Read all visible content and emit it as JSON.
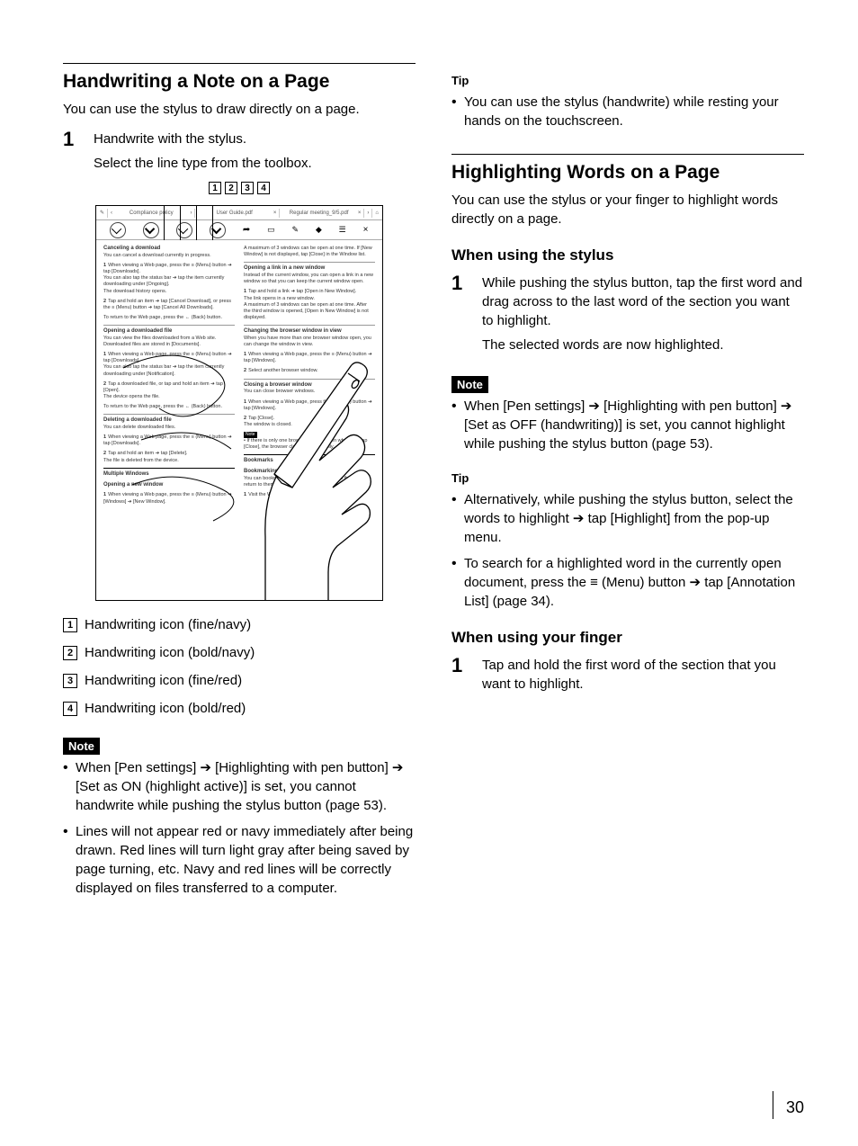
{
  "page_number": "30",
  "left": {
    "h1": "Handwriting a Note on a Page",
    "intro": "You can use the stylus to draw directly on a page.",
    "step1": {
      "num": "1",
      "line1": "Handwrite with the stylus.",
      "line2": "Select the line type from the toolbox."
    },
    "callouts": [
      "1",
      "2",
      "3",
      "4"
    ],
    "fig_toolbar": {
      "doc1": "Compliance policy",
      "doc2": "User Guide.pdf",
      "doc3": "Regular meeting_9/5.pdf"
    },
    "fig_body": {
      "canceling_h": "Canceling a download",
      "canceling_p": "You can cancel a download currently in progress.",
      "c1": "When viewing a Web page, press the ≡ (Menu) button ➔ tap [Downloads].",
      "c1b": "You can also tap the status bar ➔ tap the item currently downloading under [Ongoing].",
      "c1c": "The download history opens.",
      "c2": "Tap and hold an item ➔ tap [Cancel Download], or press the ≡ (Menu) button ➔ tap [Cancel All Downloads].",
      "c_ret": "To return to the Web page, press the ← (Back) button.",
      "open_h": "Opening a downloaded file",
      "open_p": "You can view the files downloaded from a Web site. Downloaded files are stored in [Documents].",
      "o1": "When viewing a Web page, press the ≡ (Menu) button ➔ tap [Downloads].",
      "o1b": "You can also tap the status bar ➔ tap the item currently downloading under [Notification].",
      "o2": "Tap a downloaded file, or tap and hold an item ➔ tap [Open].",
      "o2b": "The device opens the file.",
      "o_ret": "To return to the Web page, press the ← (Back) button.",
      "del_h": "Deleting a downloaded file",
      "del_p": "You can delete downloaded files.",
      "d1": "When viewing a Web page, press the ≡ (Menu) button ➔ tap [Downloads].",
      "d2": "Tap and hold an item ➔ tap [Delete].",
      "d2b": "The file is deleted from the device.",
      "mw_h": "Multiple Windows",
      "ow_h": "Opening a new window",
      "ow1": "When viewing a Web page, press the ≡ (Menu) button ➔ [Windows] ➔ [New Window].",
      "ow_p": "A maximum of 3 windows can be open at one time. If [New Window] is not displayed, tap [Close] in the Window list.",
      "link_h": "Opening a link in a new window",
      "link_p": "Instead of the current window, you can open a link in a new window so that you can keep the current window open.",
      "l1": "Tap and hold a link ➔ tap [Open in New Window].",
      "l1b": "The link opens in a new window.",
      "l1c": "A maximum of 3 windows can be open at one time. After the third window is opened, [Open in New Window] is not displayed.",
      "ch_h": "Changing the browser window in view",
      "ch_p": "When you have more than one browser window open, you can change the window in view.",
      "ch1": "When viewing a Web page, press the ≡ (Menu) button ➔ tap [Windows].",
      "ch2": "Select another browser window.",
      "cl_h": "Closing a browser window",
      "cl_p": "You can close browser windows.",
      "cl1": "When viewing a Web page, press the ≡ (Menu) button ➔ tap [Windows].",
      "cl2": "Tap [Close].",
      "cl2b": "The window is closed.",
      "cl_note": "Note",
      "cl_note1": "If there is only one browser window open when you tap [Close], the browser closes automatically.",
      "bm_h": "Bookmarks",
      "bm_sub": "Bookmarking a Web site",
      "bm_p": "You can bookmark your favorite Web sites so that you can return to them quickly.",
      "bm1": "Visit the Web site you want to bookmark."
    },
    "legend": [
      {
        "n": "1",
        "t": "Handwriting icon (fine/navy)"
      },
      {
        "n": "2",
        "t": "Handwriting icon (bold/navy)"
      },
      {
        "n": "3",
        "t": "Handwriting icon (fine/red)"
      },
      {
        "n": "4",
        "t": "Handwriting icon (bold/red)"
      }
    ],
    "note_label": "Note",
    "notes": [
      "When [Pen settings] ➔ [Highlighting with pen button] ➔ [Set as ON (highlight active)] is set, you cannot handwrite while pushing the stylus button (page 53).",
      "Lines will not appear red or navy immediately after being drawn. Red lines will turn light gray after being saved by page turning, etc. Navy and red lines will be correctly displayed on files transferred to a computer."
    ]
  },
  "right": {
    "tip_label": "Tip",
    "tip1": "You can use the stylus (handwrite) while resting your hands on the touchscreen.",
    "h1": "Highlighting Words on a Page",
    "intro": "You can use the stylus or your finger to highlight words directly on a page.",
    "h2a": "When using the stylus",
    "step1": {
      "num": "1",
      "line1": "While pushing the stylus button, tap the first word and drag across to the last word of the section you want to highlight.",
      "line2": "The selected words are now highlighted."
    },
    "note_label": "Note",
    "note1": "When [Pen settings] ➔ [Highlighting with pen button] ➔ [Set as OFF (handwriting)] is set, you cannot highlight while pushing the stylus button (page 53).",
    "tip_label2": "Tip",
    "tips2": [
      "Alternatively, while pushing the stylus button, select the words to highlight ➔ tap [Highlight] from the pop-up menu.",
      "To search for a highlighted word in the currently open document, press the ≡ (Menu) button ➔ tap [Annotation List] (page 34)."
    ],
    "h2b": "When using your finger",
    "step1b": {
      "num": "1",
      "line1": "Tap and hold the first word of the section that you want to highlight."
    }
  }
}
